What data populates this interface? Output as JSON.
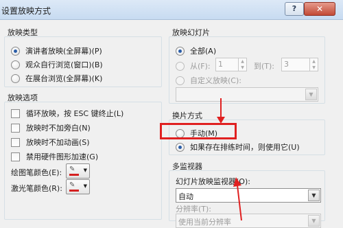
{
  "window": {
    "title": "设置放映方式",
    "help_label": "?",
    "close_label": "✕"
  },
  "show_type": {
    "label": "放映类型",
    "options": [
      {
        "label": "演讲者放映(全屏幕)(P)",
        "checked": true
      },
      {
        "label": "观众自行浏览(窗口)(B)",
        "checked": false
      },
      {
        "label": "在展台浏览(全屏幕)(K)",
        "checked": false
      }
    ]
  },
  "show_options": {
    "label": "放映选项",
    "checkboxes": [
      {
        "label": "循环放映，按 ESC 键终止(L)"
      },
      {
        "label": "放映时不加旁白(N)"
      },
      {
        "label": "放映时不加动画(S)"
      },
      {
        "label": "禁用硬件图形加速(G)"
      }
    ],
    "pen_color_label": "绘图笔颜色(E):",
    "laser_color_label": "激光笔颜色(R):",
    "pen_color": "#d42020",
    "laser_color": "#d42020"
  },
  "show_slides": {
    "label": "放映幻灯片",
    "all_label": "全部(A)",
    "from_label": "从(F):",
    "from_value": "1",
    "to_label": "到(T):",
    "to_value": "3",
    "custom_label": "自定义放映(C):",
    "custom_value": ""
  },
  "advance": {
    "label": "换片方式",
    "manual_label": "手动(M)",
    "timings_label": "如果存在排练时间，则使用它(U)"
  },
  "monitors": {
    "label": "多监视器",
    "monitor_label": "幻灯片放映监视器(O):",
    "monitor_value": "自动",
    "resolution_label": "分辨率(T):",
    "resolution_value": "使用当前分辨率"
  },
  "annotation_color": "#e02020"
}
